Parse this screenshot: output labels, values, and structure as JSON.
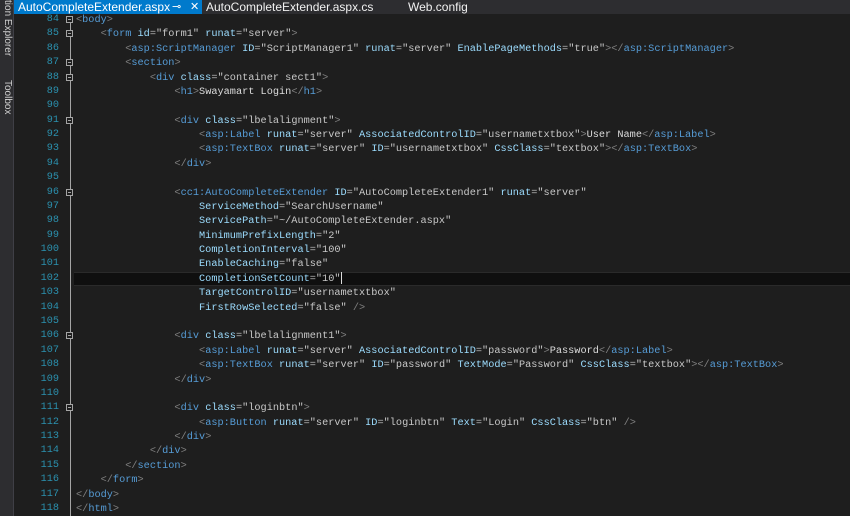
{
  "side_panels": [
    "Solution Explorer",
    "Toolbox"
  ],
  "tabs": [
    {
      "label": "AutoCompleteExtender.aspx",
      "active": true
    },
    {
      "label": "AutoCompleteExtender.aspx.cs",
      "active": false
    },
    {
      "label": "Web.config",
      "active": false
    }
  ],
  "icons": {
    "pin": "pin-icon",
    "close": "close-icon"
  },
  "cursor_line": 102,
  "lines": [
    {
      "n": 84,
      "fold": true,
      "text": "<body>"
    },
    {
      "n": 85,
      "fold": true,
      "text": "    <form id=\"form1\" runat=\"server\">"
    },
    {
      "n": 86,
      "fold": false,
      "text": "        <asp:ScriptManager ID=\"ScriptManager1\" runat=\"server\" EnablePageMethods=\"true\"></asp:ScriptManager>"
    },
    {
      "n": 87,
      "fold": true,
      "text": "        <section>"
    },
    {
      "n": 88,
      "fold": true,
      "text": "            <div class=\"container sect1\">"
    },
    {
      "n": 89,
      "fold": false,
      "text": "                <h1>Swayamart Login</h1>"
    },
    {
      "n": 90,
      "fold": false,
      "text": ""
    },
    {
      "n": 91,
      "fold": true,
      "text": "                <div class=\"lbelalignment\">"
    },
    {
      "n": 92,
      "fold": false,
      "text": "                    <asp:Label runat=\"server\" AssociatedControlID=\"usernametxtbox\">User Name</asp:Label>"
    },
    {
      "n": 93,
      "fold": false,
      "text": "                    <asp:TextBox runat=\"server\" ID=\"usernametxtbox\" CssClass=\"textbox\"></asp:TextBox>"
    },
    {
      "n": 94,
      "fold": false,
      "text": "                </div>"
    },
    {
      "n": 95,
      "fold": false,
      "text": ""
    },
    {
      "n": 96,
      "fold": true,
      "text": "                <cc1:AutoCompleteExtender ID=\"AutoCompleteExtender1\" runat=\"server\""
    },
    {
      "n": 97,
      "fold": false,
      "text": "                    ServiceMethod=\"SearchUsername\""
    },
    {
      "n": 98,
      "fold": false,
      "text": "                    ServicePath=\"~/AutoCompleteExtender.aspx\""
    },
    {
      "n": 99,
      "fold": false,
      "text": "                    MinimumPrefixLength=\"2\""
    },
    {
      "n": 100,
      "fold": false,
      "text": "                    CompletionInterval=\"100\""
    },
    {
      "n": 101,
      "fold": false,
      "text": "                    EnableCaching=\"false\""
    },
    {
      "n": 102,
      "fold": false,
      "text": "                    CompletionSetCount=\"10\""
    },
    {
      "n": 103,
      "fold": false,
      "text": "                    TargetControlID=\"usernametxtbox\""
    },
    {
      "n": 104,
      "fold": false,
      "text": "                    FirstRowSelected=\"false\" />"
    },
    {
      "n": 105,
      "fold": false,
      "text": ""
    },
    {
      "n": 106,
      "fold": true,
      "text": "                <div class=\"lbelalignment1\">"
    },
    {
      "n": 107,
      "fold": false,
      "text": "                    <asp:Label runat=\"server\" AssociatedControlID=\"password\">Password</asp:Label>"
    },
    {
      "n": 108,
      "fold": false,
      "text": "                    <asp:TextBox runat=\"server\" ID=\"password\" TextMode=\"Password\" CssClass=\"textbox\"></asp:TextBox>"
    },
    {
      "n": 109,
      "fold": false,
      "text": "                </div>"
    },
    {
      "n": 110,
      "fold": false,
      "text": ""
    },
    {
      "n": 111,
      "fold": true,
      "text": "                <div class=\"loginbtn\">"
    },
    {
      "n": 112,
      "fold": false,
      "text": "                    <asp:Button runat=\"server\" ID=\"loginbtn\" Text=\"Login\" CssClass=\"btn\" />"
    },
    {
      "n": 113,
      "fold": false,
      "text": "                </div>"
    },
    {
      "n": 114,
      "fold": false,
      "text": "            </div>"
    },
    {
      "n": 115,
      "fold": false,
      "text": "        </section>"
    },
    {
      "n": 116,
      "fold": false,
      "text": "    </form>"
    },
    {
      "n": 117,
      "fold": false,
      "text": "</body>"
    },
    {
      "n": 118,
      "fold": false,
      "text": "</html>"
    }
  ]
}
